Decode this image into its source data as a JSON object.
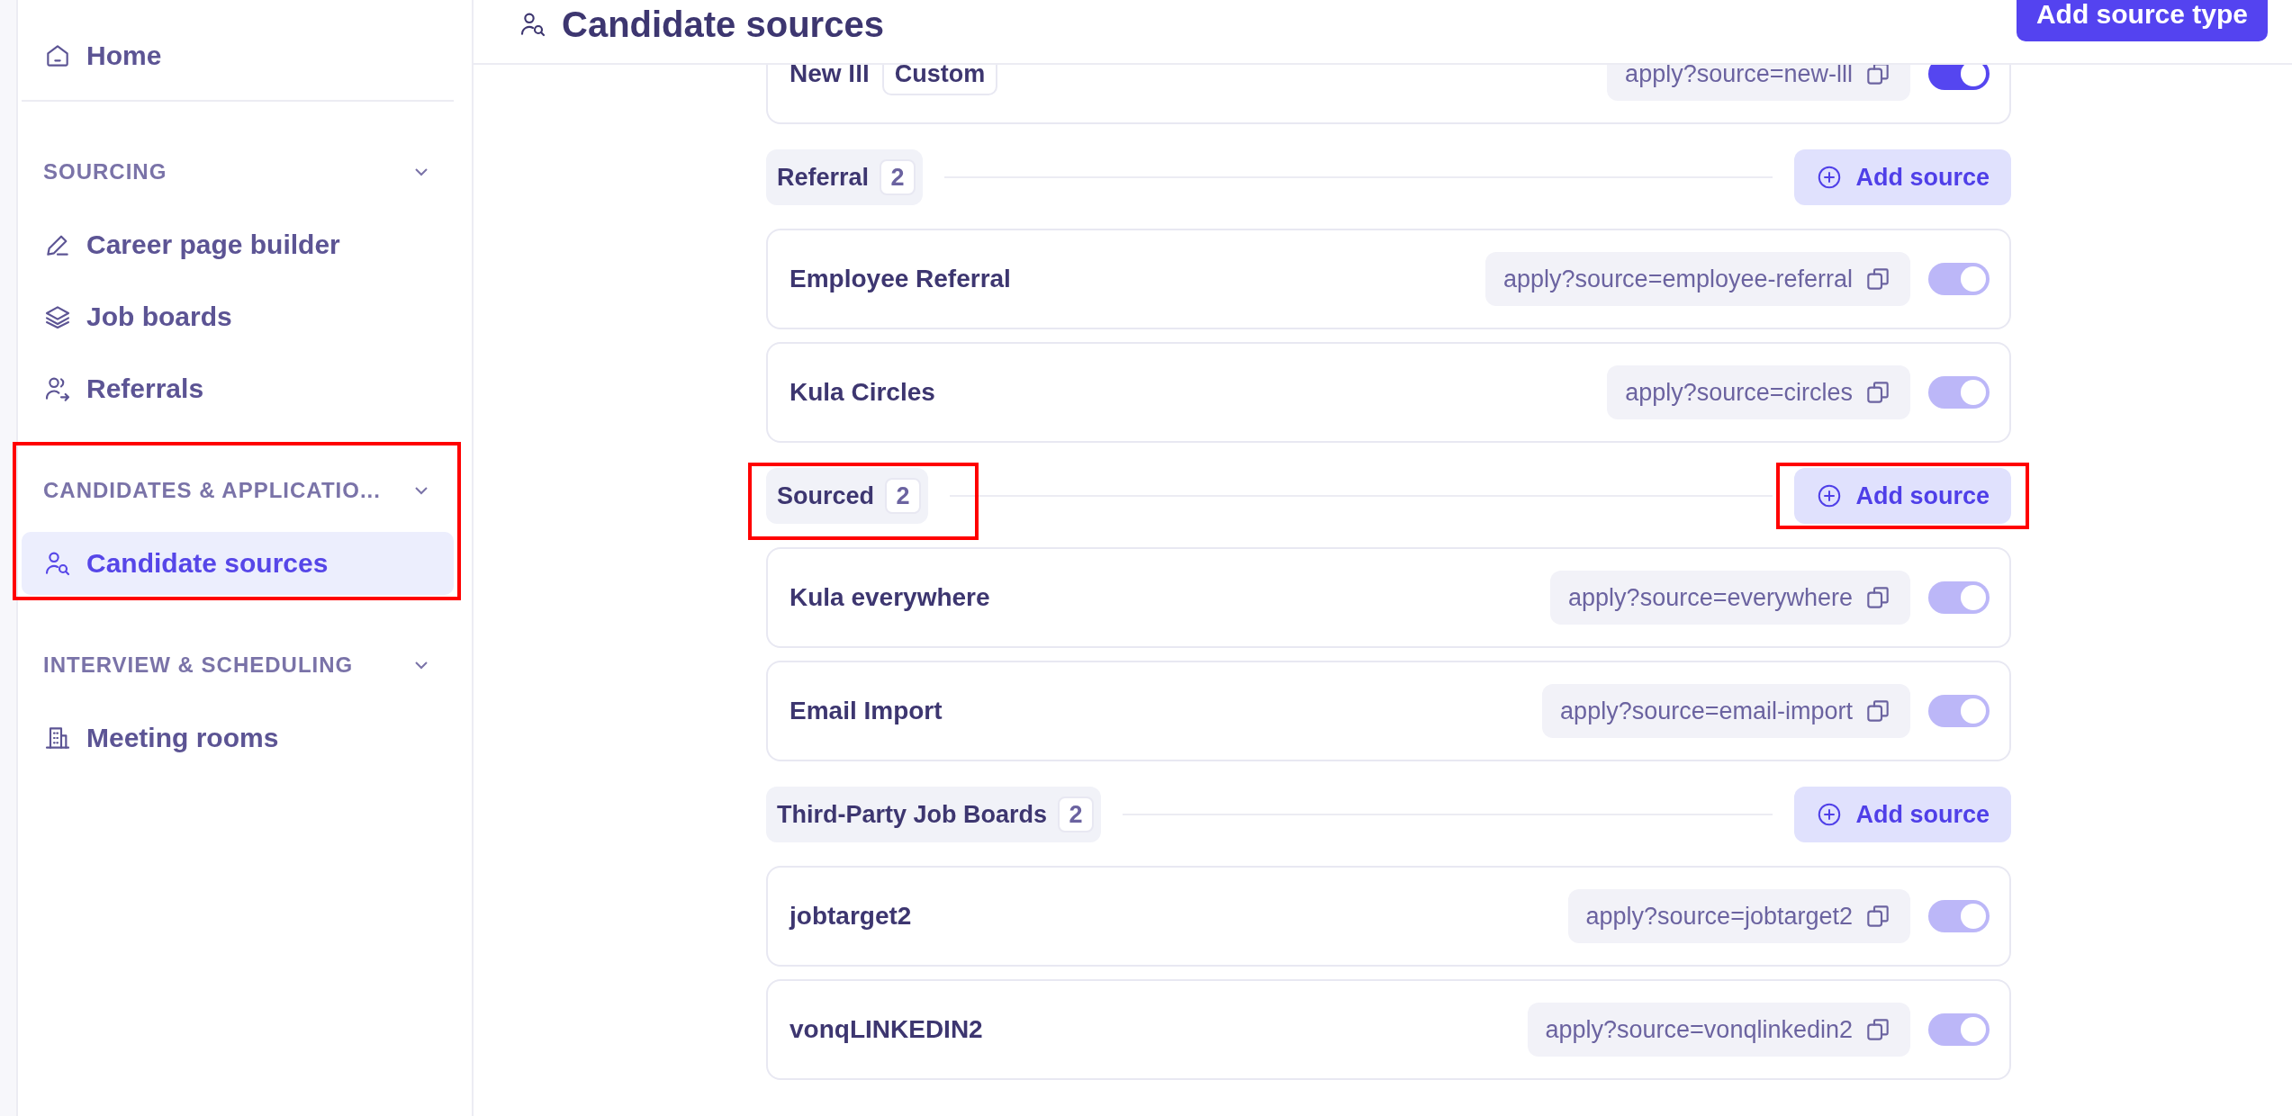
{
  "sidebar": {
    "home": {
      "label": "Home",
      "selected": false
    },
    "sections": [
      {
        "title": "SOURCING",
        "expanded": true,
        "highlighted": false,
        "items": [
          {
            "label": "Career page builder",
            "selected": false
          },
          {
            "label": "Job boards",
            "selected": false
          },
          {
            "label": "Referrals",
            "selected": false
          }
        ]
      },
      {
        "title": "CANDIDATES & APPLICATIO...",
        "expanded": true,
        "highlighted": true,
        "items": [
          {
            "label": "Candidate sources",
            "selected": true
          }
        ]
      },
      {
        "title": "INTERVIEW & SCHEDULING",
        "expanded": true,
        "highlighted": false,
        "items": [
          {
            "label": "Meeting rooms",
            "selected": false
          }
        ]
      }
    ]
  },
  "header": {
    "title": "Candidate sources",
    "action": "Add source type"
  },
  "top_source": {
    "name": "New lll",
    "tag": "Custom",
    "url": "apply?source=new-lll",
    "on": true,
    "disabled": false
  },
  "groups": [
    {
      "label": "Referral",
      "count": "2",
      "highlighted": false,
      "add_button": {
        "label": "Add source",
        "highlighted": false
      },
      "sources": [
        {
          "name": "Employee Referral",
          "url": "apply?source=employee-referral",
          "on": true,
          "disabled": true
        },
        {
          "name": "Kula Circles",
          "url": "apply?source=circles",
          "on": true,
          "disabled": true
        }
      ]
    },
    {
      "label": "Sourced",
      "count": "2",
      "highlighted": true,
      "add_button": {
        "label": "Add source",
        "highlighted": true
      },
      "sources": [
        {
          "name": "Kula everywhere",
          "url": "apply?source=everywhere",
          "on": true,
          "disabled": true
        },
        {
          "name": "Email Import",
          "url": "apply?source=email-import",
          "on": true,
          "disabled": true
        }
      ]
    },
    {
      "label": "Third-Party Job Boards",
      "count": "2",
      "highlighted": false,
      "add_button": {
        "label": "Add source",
        "highlighted": false
      },
      "sources": [
        {
          "name": "jobtarget2",
          "url": "apply?source=jobtarget2",
          "on": true,
          "disabled": true
        },
        {
          "name": "vonqLINKEDIN2",
          "url": "apply?source=vonqlinkedin2",
          "on": true,
          "disabled": true
        }
      ]
    }
  ]
}
